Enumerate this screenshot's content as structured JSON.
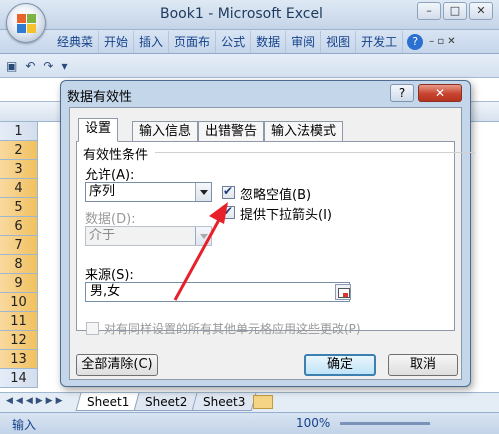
{
  "window": {
    "title": "Book1 - Microsoft Excel",
    "controls": [
      "–",
      "□",
      "✕"
    ]
  },
  "ribbon": {
    "tabs": [
      "经典菜",
      "开始",
      "插入",
      "页面布",
      "公式",
      "数据",
      "审阅",
      "视图",
      "开发工"
    ],
    "help": "?",
    "small_controls": "–  ▫  ✕"
  },
  "row_headers": [
    "1",
    "2",
    "3",
    "4",
    "5",
    "6",
    "7",
    "8",
    "9",
    "10",
    "11",
    "12",
    "13",
    "14"
  ],
  "highlighted_rows": [
    "2",
    "3",
    "4",
    "5",
    "6",
    "7",
    "8",
    "9",
    "10",
    "11",
    "12",
    "13"
  ],
  "sheet_tabs": [
    "Sheet1",
    "Sheet2",
    "Sheet3"
  ],
  "status_bar": {
    "mode": "输入",
    "zoom": "100%"
  },
  "dialog": {
    "title": "数据有效性",
    "help": "?",
    "close": "✕",
    "tabs": [
      "设置",
      "输入信息",
      "出错警告",
      "输入法模式"
    ],
    "group_label": "有效性条件",
    "allow_label": "允许(A):",
    "allow_value": "序列",
    "data_label": "数据(D):",
    "data_value": "介于",
    "ignore_blank": {
      "label": "忽略空值(B)",
      "checked": true
    },
    "dropdown": {
      "label": "提供下拉箭头(I)",
      "checked": true
    },
    "source_label": "来源(S):",
    "source_value": "男,女",
    "apply_all": {
      "label": "对有同样设置的所有其他单元格应用这些更改(P)",
      "checked": false
    },
    "clear_all_button": "全部清除(C)",
    "ok_button": "确定",
    "cancel_button": "取消"
  },
  "colors": {
    "annotation_arrow": "#e8202a",
    "highlight_row": "#f1c15f",
    "default_button": "#3c7fb1"
  }
}
